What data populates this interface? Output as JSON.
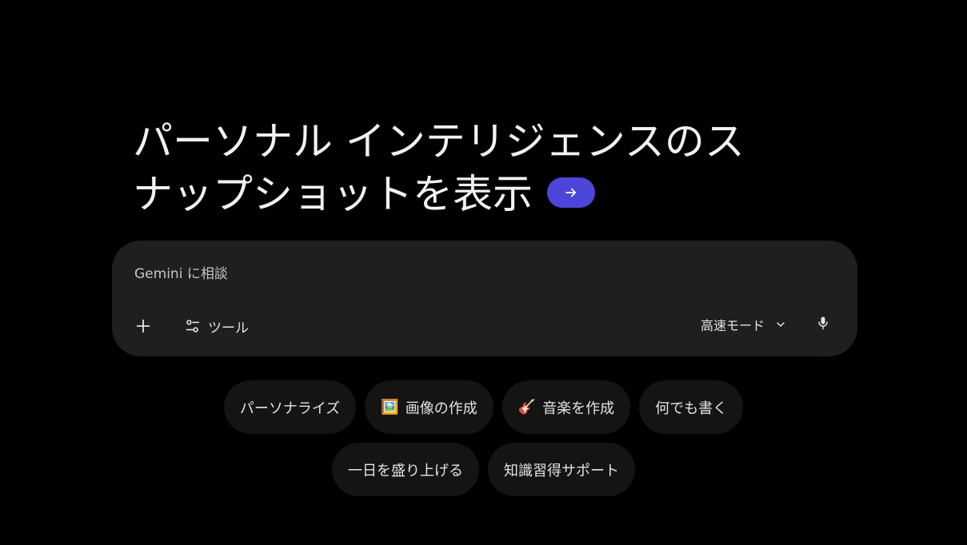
{
  "headline": {
    "line1": "パーソナル インテリジェンスのス",
    "line2": "ナップショットを表示"
  },
  "colors": {
    "background": "#000000",
    "composer": "#1e1f20",
    "chip": "#141414",
    "accent": "#4c46d8",
    "text": "#e3e3e3"
  },
  "composer": {
    "placeholder": "Gemini に相談",
    "plus_icon": "plus-icon",
    "tools_label": "ツール",
    "tools_icon": "tune-icon",
    "mode_label": "高速モード",
    "mode_icon": "chevron-down-icon",
    "mic_icon": "microphone-icon"
  },
  "chips": {
    "row1": [
      {
        "label": "パーソナライズ",
        "emoji": ""
      },
      {
        "label": "画像の作成",
        "emoji": "🖼️"
      },
      {
        "label": "音楽を作成",
        "emoji": "🎸"
      },
      {
        "label": "何でも書く",
        "emoji": ""
      }
    ],
    "row2": [
      {
        "label": "一日を盛り上げる",
        "emoji": ""
      },
      {
        "label": "知識習得サポート",
        "emoji": ""
      }
    ]
  }
}
